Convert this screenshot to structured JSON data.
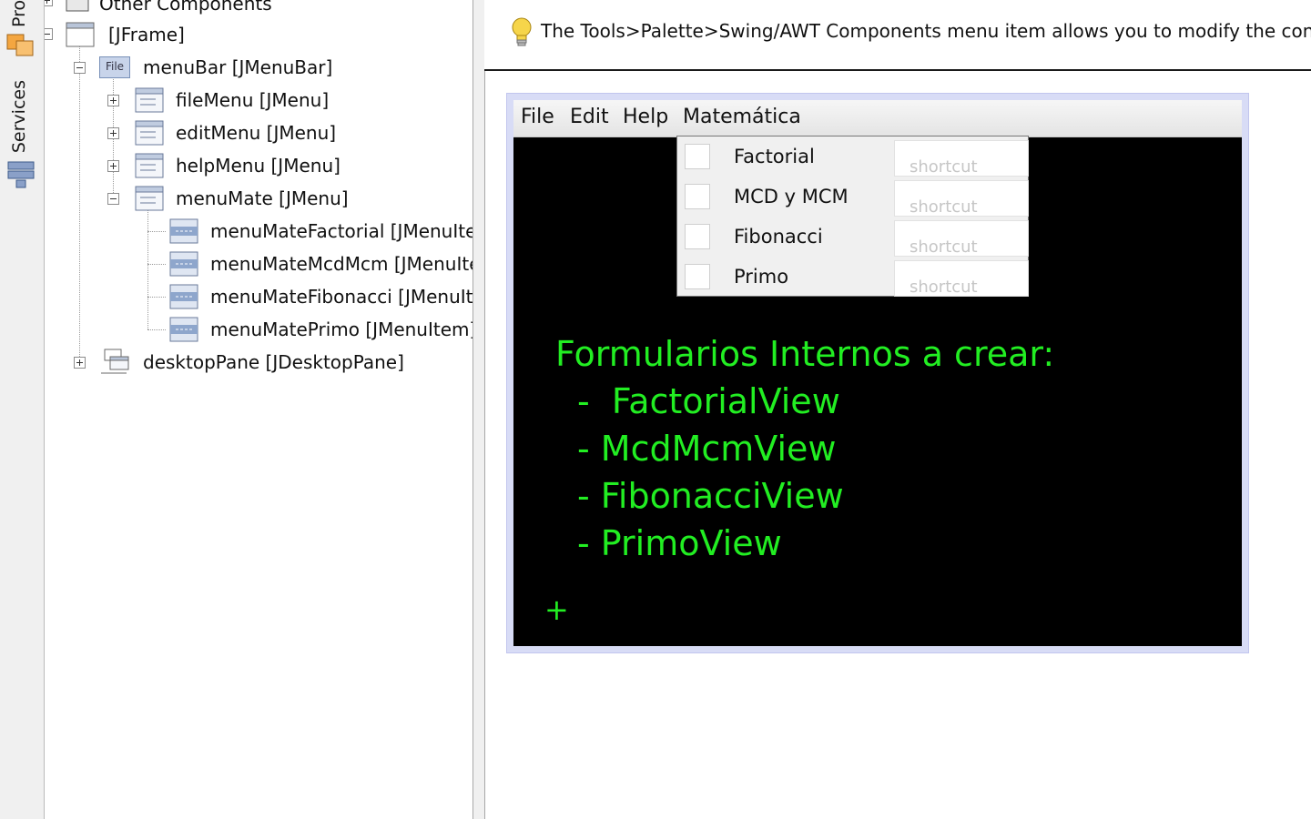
{
  "side_tabs": {
    "projects_label": "Pro",
    "services_label": "Services"
  },
  "tree": {
    "items": [
      {
        "label": "Other Components"
      },
      {
        "label": "[JFrame]"
      },
      {
        "label": "menuBar [JMenuBar]",
        "icon_text": "File"
      },
      {
        "label": "fileMenu [JMenu]"
      },
      {
        "label": "editMenu [JMenu]"
      },
      {
        "label": "helpMenu [JMenu]"
      },
      {
        "label": "menuMate [JMenu]"
      },
      {
        "label": "menuMateFactorial [JMenuIte"
      },
      {
        "label": "menuMateMcdMcm [JMenuIter"
      },
      {
        "label": "menuMateFibonacci [JMenuIte"
      },
      {
        "label": "menuMatePrimo [JMenuItem]"
      },
      {
        "label": "desktopPane [JDesktopPane]"
      }
    ]
  },
  "hint": {
    "text": "The Tools>Palette>Swing/AWT Components menu item allows you to modify the conten"
  },
  "menubar": {
    "items": [
      "File",
      "Edit",
      "Help",
      "Matemática"
    ]
  },
  "popup": {
    "items": [
      {
        "label": "Factorial",
        "shortcut": "shortcut"
      },
      {
        "label": "MCD y MCM",
        "shortcut": "shortcut"
      },
      {
        "label": "Fibonacci",
        "shortcut": "shortcut"
      },
      {
        "label": "Primo",
        "shortcut": "shortcut"
      }
    ]
  },
  "desktop": {
    "heading": "Formularios Internos a crear:",
    "lines": [
      "-  FactorialView",
      "- McdMcmView",
      "- FibonacciView",
      "- PrimoView"
    ],
    "cursor": "+"
  },
  "colors": {
    "desktop_bg": "#000000",
    "desktop_text": "#22ee22",
    "frame_border": "#d8dcf6"
  }
}
